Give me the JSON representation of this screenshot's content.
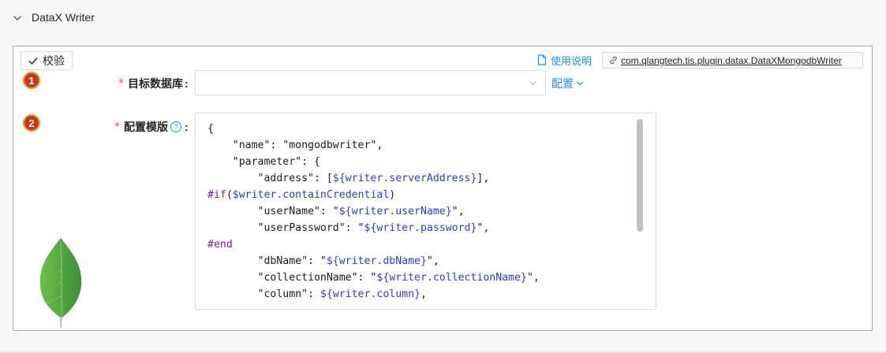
{
  "section": {
    "title": "DataX Writer"
  },
  "toolbar": {
    "verify_label": "校验"
  },
  "help": {
    "label": "使用说明"
  },
  "impl": {
    "class_name": "com.qlangtech.tis.plugin.datax.DataXMongodbWriter"
  },
  "fields": [
    {
      "index": "1",
      "label": "目标数据库",
      "required": "*",
      "colon": ":",
      "value": "",
      "action_label": "配置"
    },
    {
      "index": "2",
      "label": "配置模版",
      "required": "*",
      "colon": ":"
    }
  ],
  "template": {
    "lines": [
      "{",
      "    \"name\": \"mongodbwriter\",",
      "    \"parameter\": {",
      "        \"address\": [${writer.serverAddress}],",
      "#if($writer.containCredential)",
      "        \"userName\": \"${writer.userName}\",",
      "        \"userPassword\": \"${writer.password}\",",
      "#end",
      "        \"dbName\": \"${writer.dbName}\",",
      "        \"collectionName\": \"${writer.collectionName}\",",
      "        \"column\": ${writer.column},"
    ]
  },
  "icons": {
    "collapse": "chevron-down-icon",
    "verify": "check-icon",
    "help": "document-icon",
    "impl": "link-icon",
    "select": "chevron-down-icon",
    "action": "chevron-down-icon",
    "tip": "question-circle-icon",
    "logo": "mongodb-leaf-icon"
  },
  "colors": {
    "accent": "#1890ff",
    "badge": "#c9361a",
    "required": "#ff4d4f",
    "leaf": "#4fa94a"
  }
}
